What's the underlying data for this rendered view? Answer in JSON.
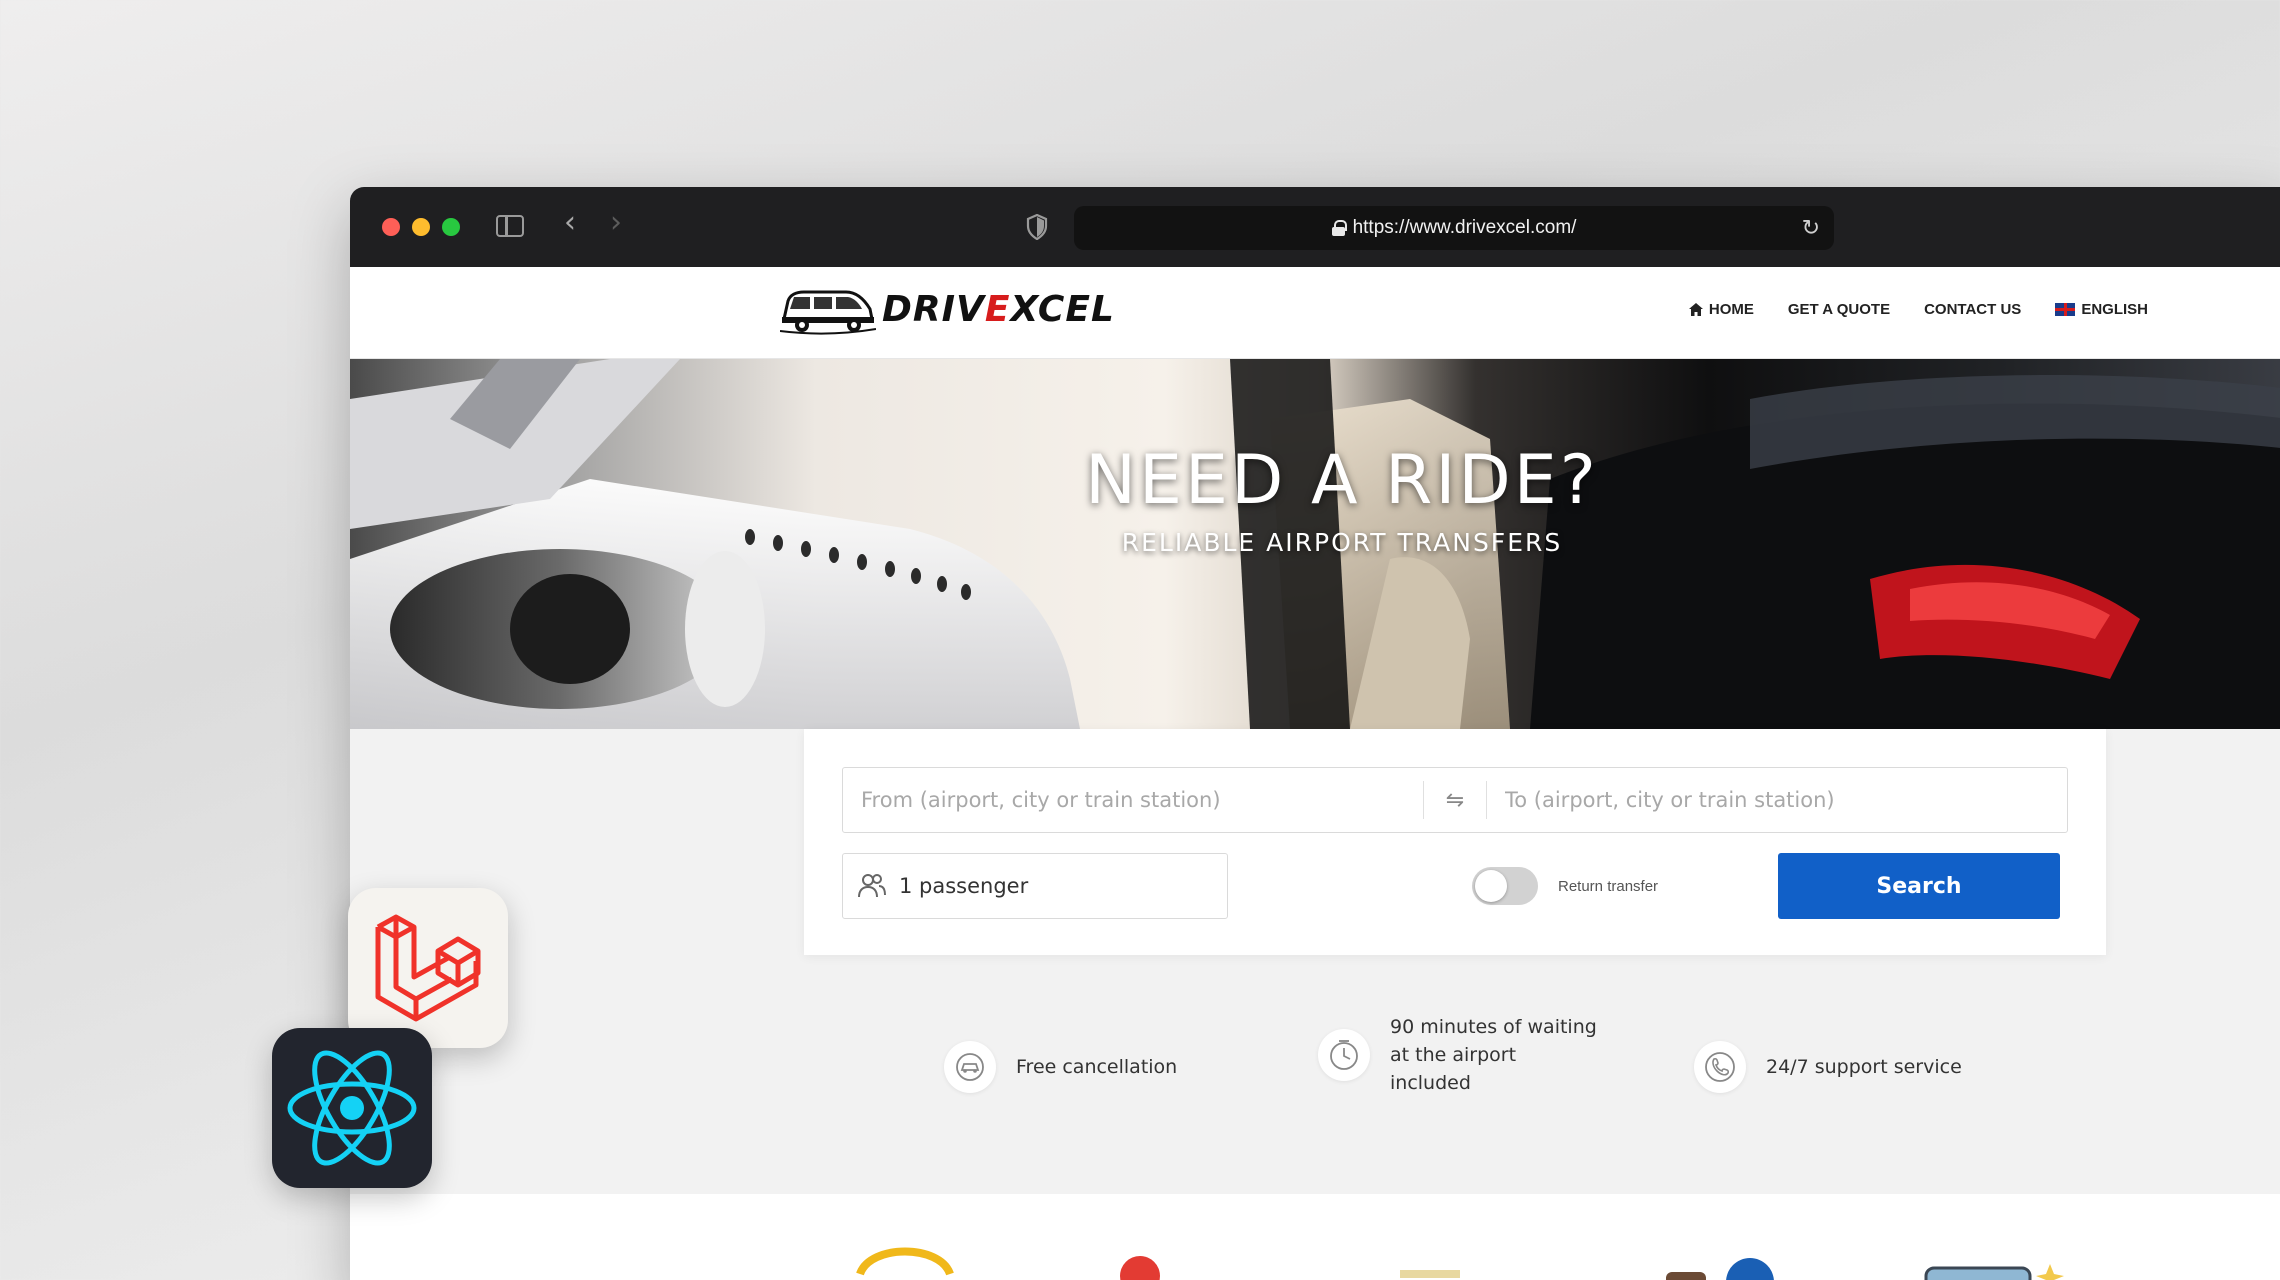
{
  "browser": {
    "url": "https://www.drivexcel.com/"
  },
  "site": {
    "logo_main": "DRIV",
    "logo_accent": "E",
    "logo_tail": "XCEL",
    "nav": [
      {
        "label": "HOME",
        "icon": "home-icon"
      },
      {
        "label": "GET A QUOTE"
      },
      {
        "label": "CONTACT US"
      },
      {
        "label": "ENGLISH",
        "icon": "uk-flag-icon"
      }
    ]
  },
  "hero": {
    "title": "NEED A RIDE?",
    "subtitle": "RELIABLE AIRPORT TRANSFERS"
  },
  "search": {
    "from_placeholder": "From (airport, city or train station)",
    "to_placeholder": "To (airport, city or train station)",
    "passengers": "1 passenger",
    "return_label": "Return transfer",
    "return_enabled": false,
    "button_label": "Search"
  },
  "features": [
    {
      "icon": "car-cancel-icon",
      "text": "Free cancellation"
    },
    {
      "icon": "clock-icon",
      "line1": "90 minutes of waiting",
      "line2": "at the airport",
      "line3": "included"
    },
    {
      "icon": "phone-icon",
      "text": "24/7 support service"
    }
  ],
  "colors": {
    "primary": "#1160c8",
    "logo_accent": "#d71c1c",
    "chrome_bg": "#1f1f21"
  },
  "badges": [
    "laravel-logo",
    "react-logo"
  ]
}
